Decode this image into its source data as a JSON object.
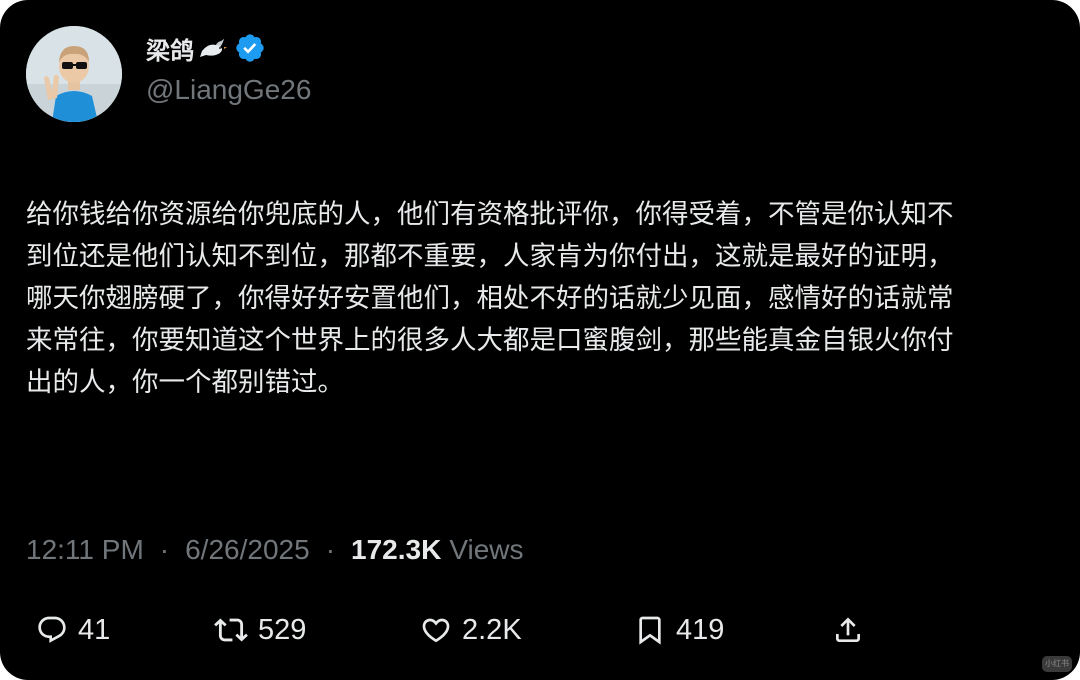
{
  "author": {
    "display_name": "梁鸽",
    "handle": "@LiangGe26",
    "verified": true,
    "name_emoji": "dove-icon"
  },
  "tweet": {
    "text": "给你钱给你资源给你兜底的人，他们有资格批评你，你得受着，不管是你认知不\n到位还是他们认知不到位，那都不重要，人家肯为你付出，这就是最好的证明，\n哪天你翅膀硬了，你得好好安置他们，相处不好的话就少见面，感情好的话就常\n来常往，你要知道这个世界上的很多人大都是口蜜腹剑，那些能真金自银火你付\n出的人，你一个都别错过。"
  },
  "meta": {
    "time": "12:11 PM",
    "separator": "·",
    "date": "6/26/2025",
    "views_count": "172.3K",
    "views_label": "Views"
  },
  "actions": {
    "replies": "41",
    "reposts": "529",
    "likes": "2.2K",
    "bookmarks": "419"
  },
  "colors": {
    "background": "#000000",
    "text": "#e7e9ea",
    "secondary": "#71767b",
    "verified_blue": "#1d9bf0"
  },
  "watermark": {
    "text": "小红书"
  }
}
